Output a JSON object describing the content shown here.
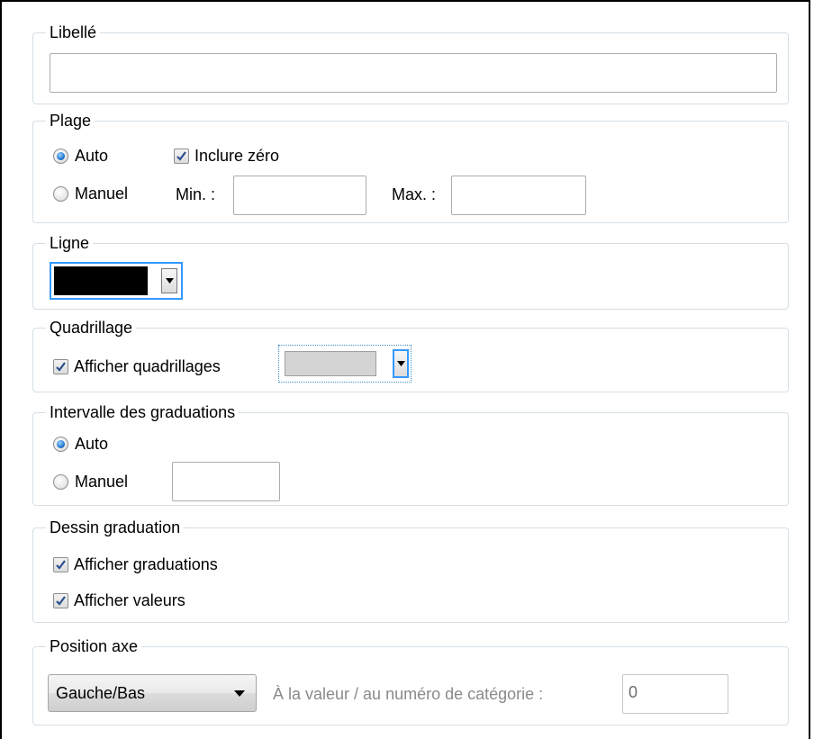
{
  "libelle": {
    "title": "Libellé",
    "value": ""
  },
  "plage": {
    "title": "Plage",
    "auto_label": "Auto",
    "auto_selected": true,
    "manuel_label": "Manuel",
    "manuel_selected": false,
    "inclure_zero_label": "Inclure zéro",
    "inclure_zero_checked": true,
    "min_label": "Min. :",
    "min_value": "",
    "max_label": "Max. :",
    "max_value": ""
  },
  "ligne": {
    "title": "Ligne",
    "color": "#000000"
  },
  "quadrillage": {
    "title": "Quadrillage",
    "afficher_label": "Afficher quadrillages",
    "afficher_checked": true,
    "color": "#d4d4d4"
  },
  "intervalle": {
    "title": "Intervalle des graduations",
    "auto_label": "Auto",
    "auto_selected": true,
    "manuel_label": "Manuel",
    "manuel_selected": false,
    "manuel_value": ""
  },
  "dessin": {
    "title": "Dessin graduation",
    "graduations_label": "Afficher graduations",
    "graduations_checked": true,
    "valeurs_label": "Afficher valeurs",
    "valeurs_checked": true
  },
  "position": {
    "title": "Position axe",
    "select_value": "Gauche/Bas",
    "value_label": "À la valeur / au numéro de catégorie :",
    "value": "0"
  },
  "colors": {
    "group_border": "#d5dfe5",
    "focus_border": "#3399ff",
    "check_mark": "#2a4f8f"
  }
}
